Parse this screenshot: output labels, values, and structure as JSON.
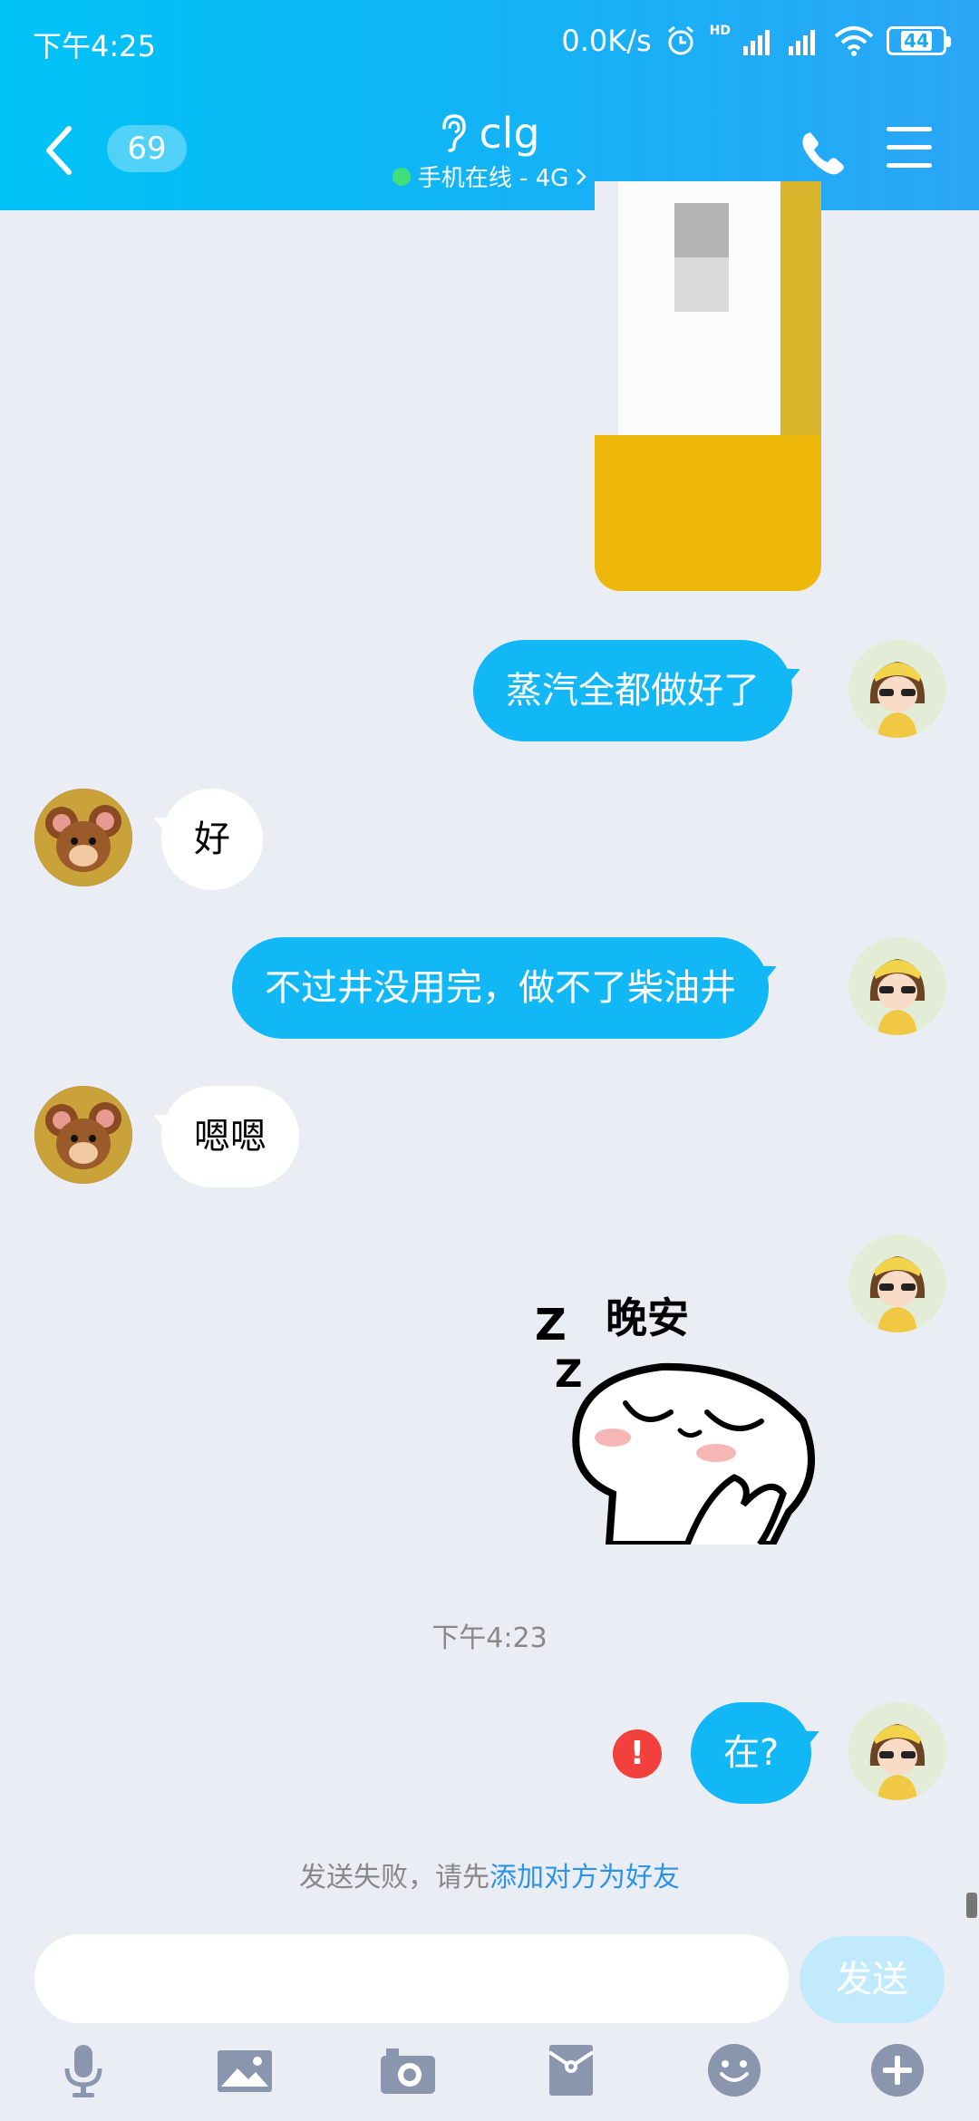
{
  "status_bar": {
    "time": "下午4:25",
    "net_speed": "0.0K/s",
    "hd_label": "HD",
    "battery": "44"
  },
  "header": {
    "unread_count": "69",
    "contact_name": "clg",
    "presence": "手机在线 - 4G"
  },
  "messages": [
    {
      "type": "image",
      "direction": "out"
    },
    {
      "type": "text",
      "direction": "out",
      "text": "蒸汽全都做好了"
    },
    {
      "type": "text",
      "direction": "in",
      "text": "好"
    },
    {
      "type": "text",
      "direction": "out",
      "text": "不过井没用完，做不了柴油井"
    },
    {
      "type": "text",
      "direction": "in",
      "text": "嗯嗯"
    },
    {
      "type": "sticker",
      "direction": "out",
      "sticker_text": "晚安"
    },
    {
      "type": "text",
      "direction": "out",
      "text": "在?",
      "failed": true
    }
  ],
  "timestamp": "下午4:23",
  "error_mark": "!",
  "fail_notice": {
    "prefix": "发送失败，请先",
    "link": "添加对方为好友"
  },
  "composer": {
    "value": "",
    "send_label": "发送"
  },
  "toolbar_icons": [
    "mic-icon",
    "picture-icon",
    "camera-icon",
    "red-packet-icon",
    "emoji-icon",
    "plus-icon"
  ],
  "colors": {
    "header_start": "#00c3f7",
    "outgoing_bubble": "#12b7f5",
    "error_red": "#f2413c",
    "link_blue": "#2b93e8",
    "chat_bg": "#eaedf4"
  }
}
